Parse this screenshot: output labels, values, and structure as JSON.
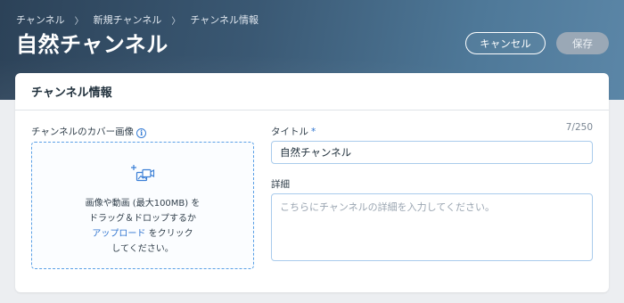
{
  "breadcrumb": {
    "items": [
      "チャンネル",
      "新規チャンネル",
      "チャンネル情報"
    ],
    "separator": "〉"
  },
  "header": {
    "title": "自然チャンネル",
    "cancel_label": "キャンセル",
    "save_label": "保存"
  },
  "card": {
    "title": "チャンネル情報",
    "cover": {
      "label": "チャンネルのカバー画像",
      "info_icon": "info-icon",
      "upload_icon": "add-media-icon",
      "line1": "画像や動画 (最大100MB) を",
      "line2": "ドラッグ＆ドロップするか",
      "link": "アップロード",
      "line3_suffix": " をクリック",
      "line4": "してください。"
    },
    "title_field": {
      "label": "タイトル",
      "required_mark": "*",
      "counter": "7/250",
      "value": "自然チャンネル"
    },
    "details_field": {
      "label": "詳細",
      "placeholder": "こちらにチャンネルの詳細を入力してください。"
    }
  },
  "colors": {
    "accent": "#2f74d0",
    "dropzone_border": "#5aa0e6",
    "save_disabled": "#9aa8b6",
    "header_dark": "#2c4258"
  }
}
